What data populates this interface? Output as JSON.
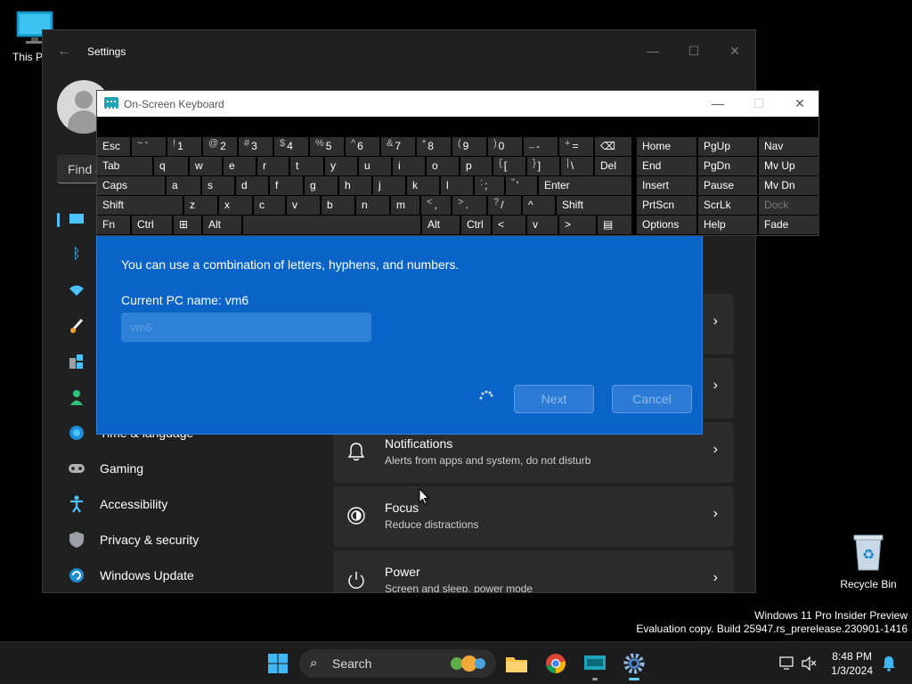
{
  "desktop": {
    "this_pc_label": "This P",
    "recycle_bin_label": "Recycle Bin"
  },
  "settings": {
    "title": "Settings",
    "search_placeholder": "Find a",
    "nav": [
      {
        "label": "",
        "icon": "display-icon"
      },
      {
        "label": "",
        "icon": "bluetooth-icon"
      },
      {
        "label": "",
        "icon": "wifi-icon"
      },
      {
        "label": "",
        "icon": "brush-icon"
      },
      {
        "label": "",
        "icon": "apps-icon"
      },
      {
        "label": "",
        "icon": "person-icon"
      },
      {
        "label": "Time & language",
        "icon": "globe-icon"
      },
      {
        "label": "Gaming",
        "icon": "gamepad-icon"
      },
      {
        "label": "Accessibility",
        "icon": "accessibility-icon"
      },
      {
        "label": "Privacy & security",
        "icon": "shield-icon"
      },
      {
        "label": "Windows Update",
        "icon": "update-icon"
      }
    ],
    "cards": [
      {
        "title": "Notifications",
        "subtitle": "Alerts from apps and system, do not disturb",
        "icon": "bell-icon"
      },
      {
        "title": "Focus",
        "subtitle": "Reduce distractions",
        "icon": "focus-icon"
      },
      {
        "title": "Power",
        "subtitle": "Screen and sleep, power mode",
        "icon": "power-icon"
      }
    ]
  },
  "rename_dialog": {
    "description": "You can use a combination of letters, hyphens, and numbers.",
    "current_name": "Current PC name: vm6",
    "input_value": "vm6",
    "next_label": "Next",
    "cancel_label": "Cancel"
  },
  "osk": {
    "title": "On-Screen Keyboard",
    "rows": [
      [
        {
          "l": "Esc"
        },
        {
          "s": "~",
          "l": "`"
        },
        {
          "s": "!",
          "l": "1"
        },
        {
          "s": "@",
          "l": "2"
        },
        {
          "s": "#",
          "l": "3"
        },
        {
          "s": "$",
          "l": "4"
        },
        {
          "s": "%",
          "l": "5"
        },
        {
          "s": "^",
          "l": "6"
        },
        {
          "s": "&",
          "l": "7"
        },
        {
          "s": "*",
          "l": "8"
        },
        {
          "s": "(",
          "l": "9"
        },
        {
          "s": ")",
          "l": "0"
        },
        {
          "s": "_",
          "l": "-"
        },
        {
          "s": "+",
          "l": "="
        },
        {
          "l": "⌫"
        },
        {
          "l": "Home"
        },
        {
          "l": "PgUp"
        },
        {
          "l": "Nav"
        }
      ],
      [
        {
          "l": "Tab"
        },
        {
          "l": "q"
        },
        {
          "l": "w"
        },
        {
          "l": "e"
        },
        {
          "l": "r"
        },
        {
          "l": "t"
        },
        {
          "l": "y"
        },
        {
          "l": "u"
        },
        {
          "l": "i"
        },
        {
          "l": "o"
        },
        {
          "l": "p"
        },
        {
          "s": "{",
          "l": "["
        },
        {
          "s": "}",
          "l": "]"
        },
        {
          "s": "|",
          "l": "\\"
        },
        {
          "l": "Del"
        },
        {
          "l": "End"
        },
        {
          "l": "PgDn"
        },
        {
          "l": "Mv Up"
        }
      ],
      [
        {
          "l": "Caps"
        },
        {
          "l": "a"
        },
        {
          "l": "s"
        },
        {
          "l": "d"
        },
        {
          "l": "f"
        },
        {
          "l": "g"
        },
        {
          "l": "h"
        },
        {
          "l": "j"
        },
        {
          "l": "k"
        },
        {
          "l": "l"
        },
        {
          "s": ":",
          "l": ";"
        },
        {
          "s": "\"",
          "l": "'"
        },
        {
          "l": "Enter"
        },
        {
          "l": "Insert"
        },
        {
          "l": "Pause"
        },
        {
          "l": "Mv Dn"
        }
      ],
      [
        {
          "l": "Shift"
        },
        {
          "l": "z"
        },
        {
          "l": "x"
        },
        {
          "l": "c"
        },
        {
          "l": "v"
        },
        {
          "l": "b"
        },
        {
          "l": "n"
        },
        {
          "l": "m"
        },
        {
          "s": "<",
          "l": ","
        },
        {
          "s": ">",
          "l": "."
        },
        {
          "s": "?",
          "l": "/"
        },
        {
          "l": "^"
        },
        {
          "l": "Shift"
        },
        {
          "l": "PrtScn"
        },
        {
          "l": "ScrLk"
        },
        {
          "l": "Dock"
        }
      ],
      [
        {
          "l": "Fn"
        },
        {
          "l": "Ctrl"
        },
        {
          "l": "⊞"
        },
        {
          "l": "Alt"
        },
        {
          "l": ""
        },
        {
          "l": "Alt"
        },
        {
          "l": "Ctrl"
        },
        {
          "l": "<"
        },
        {
          "l": "v"
        },
        {
          "l": ">"
        },
        {
          "l": "▤"
        },
        {
          "l": "Options"
        },
        {
          "l": "Help"
        },
        {
          "l": "Fade"
        }
      ]
    ]
  },
  "watermark": {
    "line1": "Windows 11 Pro Insider Preview",
    "line2": "Evaluation copy. Build 25947.rs_prerelease.230901-1416"
  },
  "taskbar": {
    "search_label": "Search",
    "time": "8:48 PM",
    "date": "1/3/2024"
  }
}
